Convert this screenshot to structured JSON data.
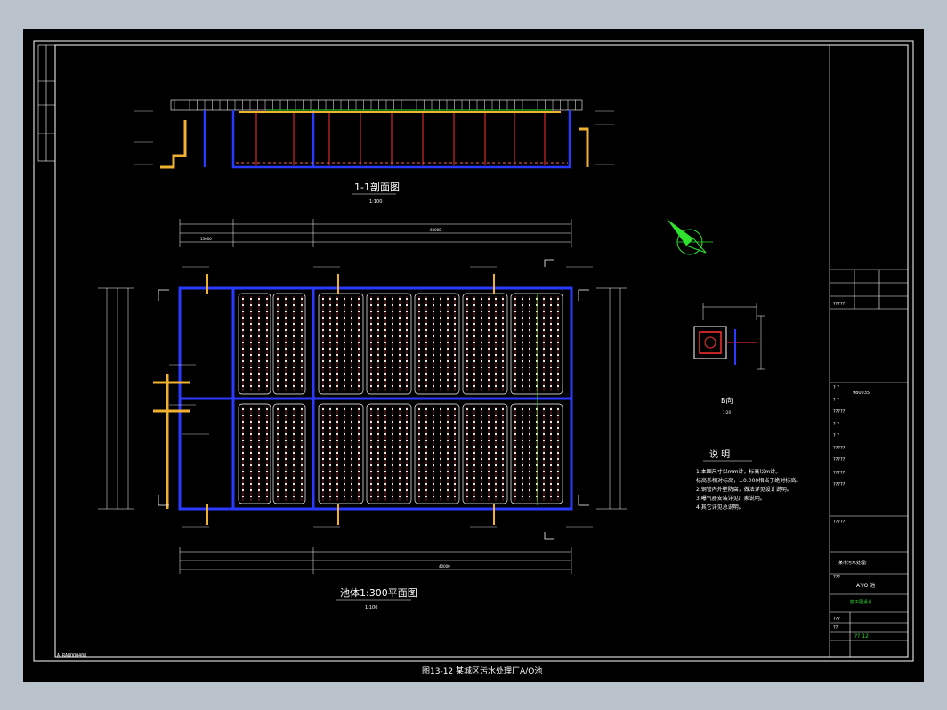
{
  "drawing": {
    "caption": "图13-12 某城区污水处理厂A/O池",
    "file_ref": "A-RABOOO408",
    "section": {
      "title": "1-1剖面图",
      "scale": "1:100"
    },
    "plan": {
      "title": "池体1:300平面图",
      "scale": "1:100"
    },
    "detail": {
      "title": "B向",
      "scale": "1:20"
    },
    "notes": {
      "title": "说  明",
      "lines": [
        "1.本图尺寸以mm计，标高以m计。",
        "标高系相对标高，±0.000相当于绝对标高。",
        "2.钢管内外壁防腐，做法详见设计说明。",
        "3.曝气器安装详见厂家说明。",
        "4.其它详见总说明。"
      ]
    },
    "dimensions": {
      "plan_total": "60000",
      "plan_mid": "40000",
      "plan_left": "13000"
    },
    "title_block": {
      "rows": [
        "?????",
        "? ?",
        "? ?",
        "?????",
        "? ?",
        "? ?",
        "?????",
        "?????",
        "?????",
        "?????",
        "?????",
        "???",
        "???",
        "??"
      ],
      "project": "某市污水处理厂",
      "drawing_name": "A²/O 池",
      "stage": "施工图设计",
      "sheet_no": "?? 12",
      "code": "980035",
      "x_label": "?????"
    }
  },
  "colors": {
    "background": "#000000",
    "frame": "#ffffff",
    "wall": "#2a3bff",
    "pipe_red": "#ff3030",
    "pipe_yellow": "#f0b030",
    "diffuser": "#ffffff",
    "green": "#2fe02f",
    "cyan": "#30e0e0"
  }
}
